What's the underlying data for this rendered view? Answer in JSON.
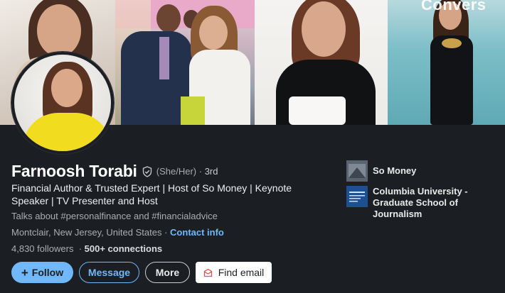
{
  "profile": {
    "name": "Farnoosh Torabi",
    "pronouns": "(She/Her)",
    "degree_prefix": "·",
    "degree": "3rd",
    "headline": "Financial Author & Trusted Expert | Host of So Money | Keynote Speaker | TV Presenter and Host",
    "talks_about": "Talks about #personalfinance and #financialadvice",
    "location": "Montclair, New Jersey, United States",
    "location_sep": "·",
    "contact_info_label": "Contact info",
    "followers": "4,830 followers",
    "connections_sep": "·",
    "connections": "500+ connections"
  },
  "banner": {
    "brand_text": "Convers"
  },
  "actions": {
    "follow_icon": "+",
    "follow_label": "Follow",
    "message_label": "Message",
    "more_label": "More",
    "find_email_label": "Find email"
  },
  "side": {
    "items": [
      {
        "label": "So Money",
        "icon": "so-money-logo"
      },
      {
        "label": "Columbia University - Graduate School of Journalism",
        "icon": "columbia-logo"
      }
    ]
  },
  "colors": {
    "background": "#1b1f23",
    "accent": "#71b7fb",
    "text": "#e9e9e9",
    "muted": "#a9adb1"
  }
}
